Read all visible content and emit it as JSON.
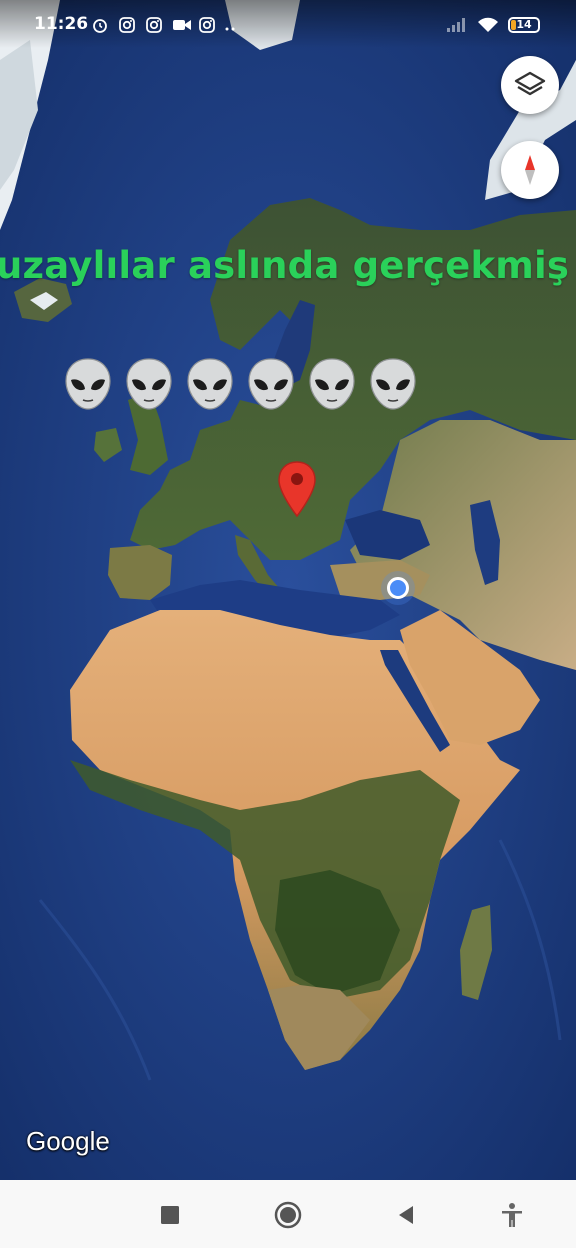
{
  "status_bar": {
    "time": "11:26",
    "battery_level": "14",
    "left_icons": [
      "alarm-icon",
      "instagram-icon",
      "instagram-icon",
      "video-camera-icon",
      "instagram-icon",
      "more-dots-icon"
    ],
    "right_icons": [
      "signal-icon",
      "wifi-icon",
      "battery-icon"
    ]
  },
  "map": {
    "type": "satellite",
    "region_shown": [
      "Europe",
      "Africa",
      "Middle East"
    ],
    "attribution": "Google",
    "colors": {
      "ocean": "#1d3b7e",
      "desert": "#d9a36a",
      "forest": "#3f5a2a",
      "pin": "#e8352a",
      "location_dot": "#4a8cf7"
    }
  },
  "controls": {
    "layers_icon": "layers-icon",
    "compass_icon": "compass-icon"
  },
  "overlay": {
    "caption": "uzaylılar aslında gerçekmiş",
    "caption_color": "#2ad15a",
    "emoji_count": 6,
    "emoji_icon": "alien-emoji"
  },
  "nav_bar": {
    "buttons": [
      "recents-icon",
      "home-icon",
      "back-icon",
      "accessibility-icon"
    ]
  }
}
